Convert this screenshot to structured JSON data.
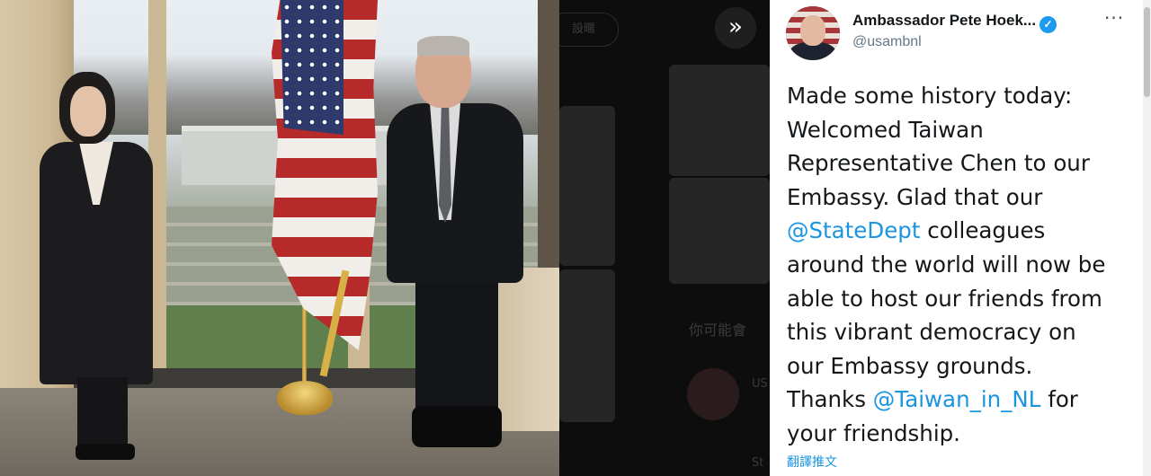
{
  "overlay": {
    "next_icon": "»"
  },
  "background_page": {
    "tab_label": "設暱",
    "section_title": "你可能會",
    "suggest_1": "US",
    "suggest_2": "St"
  },
  "tweet": {
    "author_name": "Ambassador Pete Hoek...",
    "verified_icon": "✓",
    "handle": "@usambnl",
    "more_icon": "···",
    "lines": {
      "l1": "Made some history today:",
      "l2": "Welcomed Taiwan",
      "l3": "Representative Chen to our",
      "l4": "Embassy. Glad that our",
      "l5_mention": "@StateDept",
      "l5_text": " colleagues",
      "l6": "around the world will now be",
      "l7": "able to host our friends from",
      "l8": "this vibrant democracy on",
      "l9": "our Embassy grounds.",
      "l10_pre": "Thanks ",
      "l10_mention": "@Taiwan_in_NL",
      "l10_post": " for",
      "l11": "your friendship."
    },
    "translate_label": "翻譯推文"
  },
  "colors": {
    "link": "#1b95e0",
    "verified": "#1d9bf0"
  }
}
